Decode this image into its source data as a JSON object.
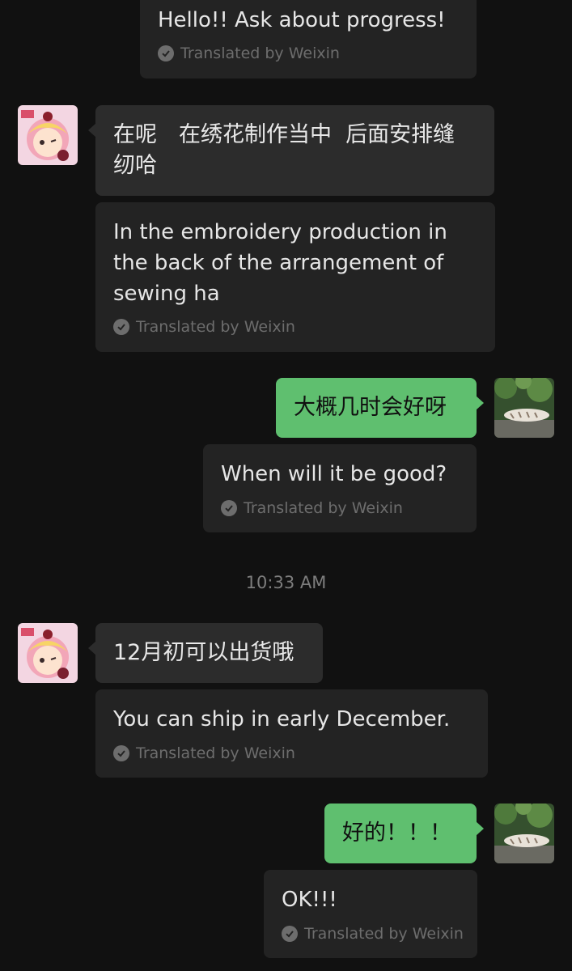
{
  "chat": {
    "timestamp": "10:33 AM",
    "translation_tag": "Translated by Weixin",
    "messages": [
      {
        "side": "out",
        "translation": "Hello!! Ask about progress!"
      },
      {
        "side": "in",
        "text": "在呢　在绣花制作当中  后面安排缝纫哈",
        "translation": "In the embroidery production in the back of the arrangement of sewing ha"
      },
      {
        "side": "out",
        "text": "大概几时会好呀",
        "translation": "When will it be good?"
      },
      {
        "side": "in",
        "text": "12月初可以出货哦",
        "translation": "You can ship in early December."
      },
      {
        "side": "out",
        "text": "好的！！！",
        "translation": "OK!!!"
      }
    ]
  },
  "avatars": {
    "contact": "anime-girl-avatar",
    "self": "tiger-photo-avatar"
  },
  "colors": {
    "background": "#111111",
    "incoming_bubble": "#2c2c2c",
    "outgoing_bubble": "#5fbf6f",
    "translation_card": "#232323",
    "muted_text": "#6d6d6d"
  }
}
